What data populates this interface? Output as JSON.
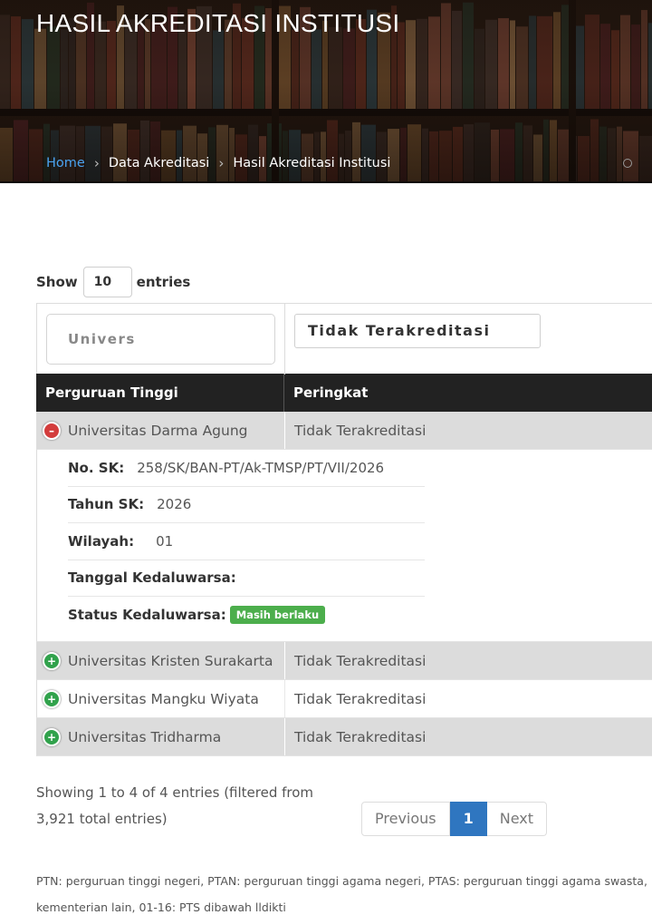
{
  "hero": {
    "title": "HASIL AKREDITASI INSTITUSI",
    "breadcrumb": [
      "Home",
      "Data Akreditasi",
      "Hasil Akreditasi Institusi"
    ]
  },
  "length": {
    "show_label": "Show",
    "value": "10",
    "entries_label": "entries"
  },
  "filters": {
    "institution_value": "Univers",
    "rank_value": "Tidak Terakreditasi"
  },
  "table": {
    "headers": [
      "Perguruan Tinggi",
      "Peringkat"
    ],
    "rows": [
      {
        "name": "Universitas Darma Agung",
        "rank": "Tidak Terakreditasi",
        "expanded": true
      },
      {
        "name": "Universitas Kristen Surakarta",
        "rank": "Tidak Terakreditasi",
        "expanded": false
      },
      {
        "name": "Universitas Mangku Wiyata",
        "rank": "Tidak Terakreditasi",
        "expanded": false
      },
      {
        "name": "Universitas Tridharma",
        "rank": "Tidak Terakreditasi",
        "expanded": false
      }
    ],
    "detail": {
      "no_sk_label": "No. SK:",
      "no_sk_value": "258/SK/BAN-PT/Ak-TMSP/PT/VII/2026",
      "tahun_label": "Tahun SK:",
      "tahun_value": "2026",
      "wilayah_label": "Wilayah:",
      "wilayah_value": "01",
      "tanggal_label": "Tanggal Kedaluwarsa:",
      "status_label": "Status Kedaluwarsa:",
      "status_badge": "Masih berlaku"
    }
  },
  "info": {
    "line1": "Showing 1 to 4 of 4 entries (filtered from",
    "line2": "3,921 total entries)"
  },
  "pagination": {
    "previous": "Previous",
    "current": "1",
    "next": "Next"
  },
  "note": {
    "line1": "PTN: perguruan tinggi negeri, PTAN: perguruan tinggi agama negeri, PTAS: perguruan tinggi agama swasta, P",
    "line2": "kementerian lain, 01-16: PTS dibawah lldikti"
  },
  "colors": {
    "accent": "#2f76c0",
    "link": "#4aa3f0",
    "expand_open": "#d33c3c",
    "expand_closed": "#31a24c",
    "badge": "#4cae4c",
    "header_bg": "#222222"
  }
}
